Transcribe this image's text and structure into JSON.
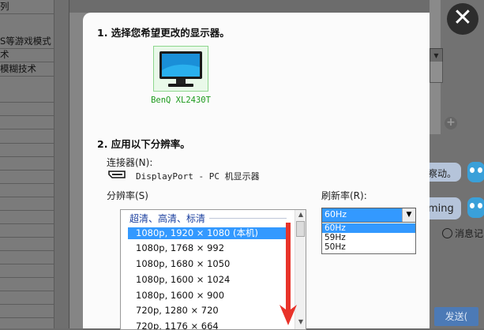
{
  "background_sidebar": {
    "items": [
      "列",
      "S等游戏模式",
      "术",
      "模糊技术"
    ]
  },
  "close_symbol": "✕",
  "dialog": {
    "step1_title": "1. 选择您希望更改的显示器。",
    "monitor_name": "BenQ XL2430T",
    "step2_title": "2. 应用以下分辨率。",
    "connector_label": "连接器(N):",
    "connector_value": "DisplayPort - PC 机显示器",
    "resolution_label": "分辨率(S)",
    "refresh_label": "刷新率(R):",
    "resolution_group": "超清、高清、标清",
    "resolutions": [
      "1080p, 1920 × 1080 (本机)",
      "1080p, 1768 × 992",
      "1080p, 1680 × 1050",
      "1080p, 1600 × 1024",
      "1080p, 1600 × 900",
      "720p, 1280 × 720",
      "720p, 1176 × 664"
    ],
    "refresh_selected": "60Hz",
    "refresh_options": [
      "60Hz",
      "59Hz",
      "50Hz"
    ]
  },
  "chat": {
    "bubble1": "察动。",
    "bubble2": "ming",
    "history": "消息记",
    "send": "发送("
  },
  "colors": {
    "selection": "#3399ff",
    "monitor_name": "#1c9a1c",
    "annotation_arrow": "#e8332a"
  }
}
